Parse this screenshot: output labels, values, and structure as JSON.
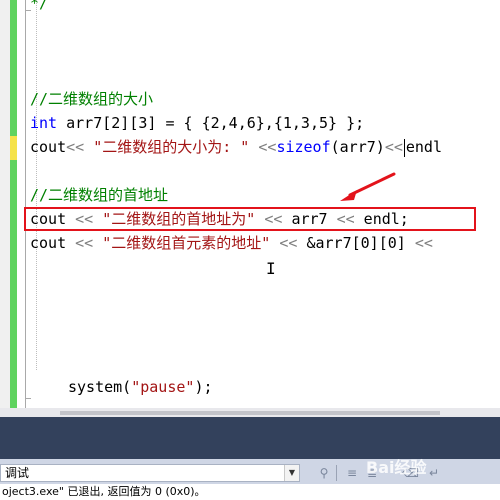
{
  "editor": {
    "lines": {
      "comment_end": "*/",
      "comment_size": "//二维数组的大小",
      "decl_kw": "int",
      "decl_rest": " arr7[2][3] = { {2,4,6},{1,3,5} };",
      "cout1_ident": "cout",
      "cout1_op1": "<< ",
      "cout1_str": "\"二维数组的大小为: \"",
      "cout1_op2": " <<",
      "cout1_kw": "sizeof",
      "cout1_rest": "(arr7)",
      "cout1_op3": "<<",
      "cout1_end": "endl",
      "comment_addr": "//二维数组的首地址",
      "cout2_ident": "cout ",
      "cout2_op1": "<< ",
      "cout2_str": "\"二维数组的首地址为\"",
      "cout2_op2": " << ",
      "cout2_mid": "arr7 ",
      "cout2_op3": "<<",
      "cout2_end": " endl;",
      "cout3_ident": "cout ",
      "cout3_op1": "<< ",
      "cout3_str": "\"二维数组首元素的地址\"",
      "cout3_op2": " << ",
      "cout3_mid": "&arr7[0][0] ",
      "cout3_op3": "<<",
      "sys_ident": "system(",
      "sys_str": "\"pause\"",
      "sys_end": ");"
    }
  },
  "output_panel": {
    "dropdown_value": "调试",
    "status_line": "oject3.exe\" 已退出, 返回值为 0 (0x0)。"
  },
  "watermark": "Bai经验",
  "colors": {
    "highlight_box": "#e3131b",
    "arrow": "#e3131b",
    "comment": "#008000",
    "keyword": "#0000ff",
    "string": "#a31515"
  },
  "icons": {
    "toolbar": [
      "find-icon",
      "align-left-icon",
      "align-right-icon",
      "clear-icon",
      "word-wrap-icon"
    ]
  }
}
